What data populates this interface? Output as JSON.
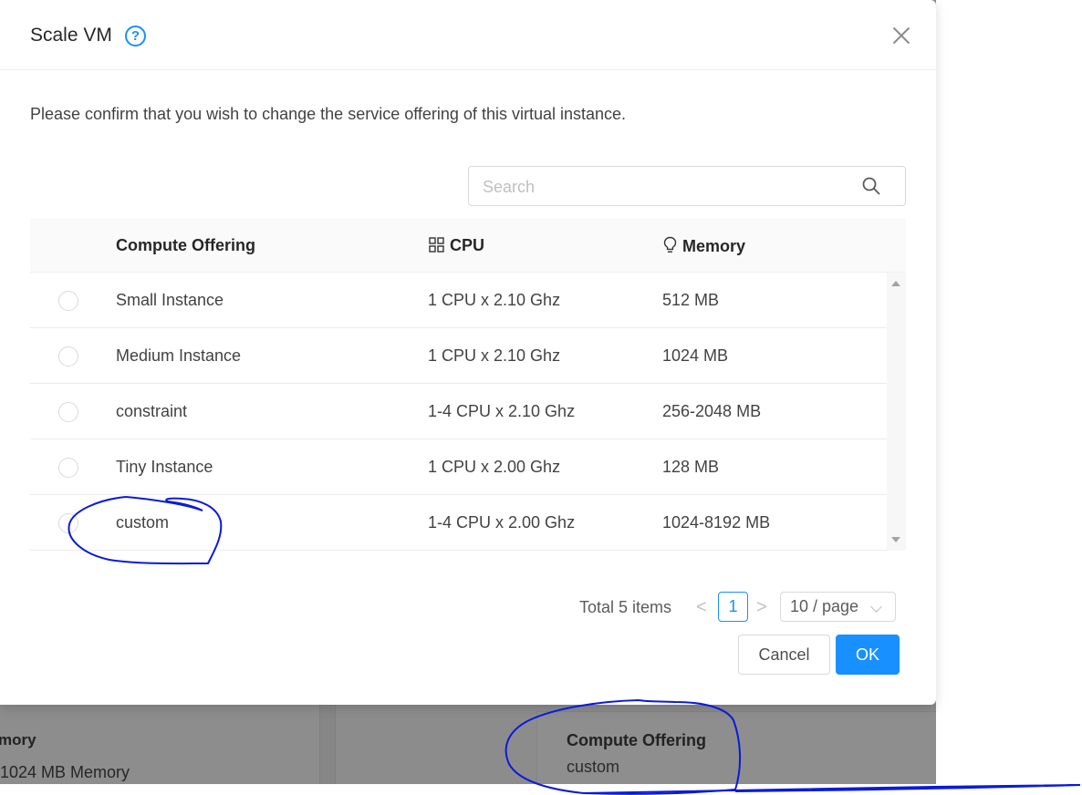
{
  "background": {
    "memory_label": "mory",
    "memory_value": "1024 MB Memory",
    "compute_offering_label": "Compute Offering",
    "compute_offering_value": "custom"
  },
  "modal": {
    "title": "Scale VM",
    "help_icon": "question-circle-icon",
    "close_icon": "close-icon",
    "confirm_text": "Please confirm that you wish to change the service offering of this virtual instance.",
    "search": {
      "placeholder": "Search",
      "value": ""
    },
    "table": {
      "columns": [
        {
          "label": "Compute Offering",
          "icon": ""
        },
        {
          "label": "CPU",
          "icon": "appstore-icon"
        },
        {
          "label": "Memory",
          "icon": "bulb-icon"
        }
      ],
      "rows": [
        {
          "name": "Small Instance",
          "cpu": "1 CPU x 2.10 Ghz",
          "memory": "512 MB",
          "selected": false
        },
        {
          "name": "Medium Instance",
          "cpu": "1 CPU x 2.10 Ghz",
          "memory": "1024 MB",
          "selected": false
        },
        {
          "name": "constraint",
          "cpu": "1-4 CPU x 2.10 Ghz",
          "memory": "256-2048 MB",
          "selected": false
        },
        {
          "name": "Tiny Instance",
          "cpu": "1 CPU x 2.00 Ghz",
          "memory": "128 MB",
          "selected": false
        },
        {
          "name": "custom",
          "cpu": "1-4 CPU x 2.00 Ghz",
          "memory": "1024-8192 MB",
          "selected": false
        }
      ]
    },
    "pagination": {
      "total_text": "Total 5 items",
      "prev": "<",
      "current_page": "1",
      "next": ">",
      "page_size": "10 / page"
    },
    "buttons": {
      "cancel": "Cancel",
      "ok": "OK"
    }
  },
  "colors": {
    "primary": "#1890ff",
    "annotation_ink": "#0a1adc",
    "overlay": "#8c8c8c"
  }
}
